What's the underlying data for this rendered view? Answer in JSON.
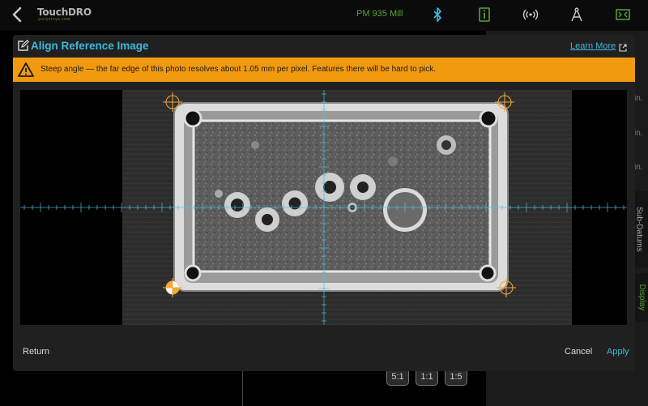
{
  "app": {
    "brand_main": "TouchDRO",
    "brand_accent": "",
    "brand_sub": "yuriystoys.com",
    "machine_name": "PM 935 Mill",
    "accent_color": "#3fb8dc",
    "green_color": "#5aa13a",
    "warning_color": "#f29a0f",
    "top_icons": [
      "bluetooth-icon",
      "info-icon",
      "broadcast-icon",
      "compass-icon",
      "fullscreen-icon"
    ],
    "side_units": [
      "in.",
      "in.",
      "in."
    ],
    "side_tabs": [
      "Sub-Datums",
      "Display"
    ],
    "zoom_buttons": [
      "5:1",
      "1:1",
      "1:5"
    ]
  },
  "dialog": {
    "title": "Align Reference Image",
    "learn_more": "Learn More",
    "warning": "Steep angle — the far edge of this photo resolves about 1.05 mm per pixel. Features there will be hard to pick.",
    "buttons": {
      "return": "Return",
      "cancel": "Cancel",
      "apply": "Apply"
    }
  }
}
